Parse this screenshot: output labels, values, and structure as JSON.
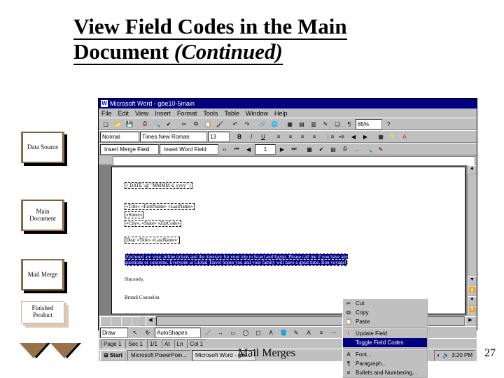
{
  "title_line1": "View Field Codes in the Main",
  "title_line2a": "Document ",
  "title_line2b": "(Continued)",
  "side_buttons": {
    "data_source": "Data Source",
    "main_doc": "Main Document",
    "mail_merge": "Mail Merge",
    "finished": "Finished Product"
  },
  "word": {
    "title": "Microsoft Word - gbe10-5main",
    "menus": [
      "File",
      "Edit",
      "View",
      "Insert",
      "Format",
      "Tools",
      "Table",
      "Window",
      "Help"
    ],
    "style_combo": "Normal",
    "font_combo": "Times New Roman",
    "size_combo": "13",
    "zoom": "85%",
    "mm_insert_field": "Insert Merge Field",
    "mm_insert_word": "Insert Word Field",
    "mm_recnum": "1",
    "doc": {
      "date": "{ DATE \\@ \"MMMM d, yyyy\" }",
      "addr1": "«Title» «FirstName» «LastName»",
      "addr2": "«Street»",
      "addr3": "«City», «State» «ZipCode»",
      "salut": "Dear «Title» «LastName»:",
      "body": "Enclosed are your airline tickets and the itinerary for your trip to Israel and Egypt. Please call me if you have any questions or concerns. Everyone at Global Travel hopes you and your family will have a great time. Bon voyage!",
      "closing": "Sincerely,",
      "sig": "Brandi Courselon"
    },
    "context": {
      "cut": "Cut",
      "copy": "Copy",
      "paste": "Paste",
      "update": "Update Field",
      "toggle": "Toggle Field Codes",
      "font": "Font...",
      "para": "Paragraph...",
      "bullets": "Bullets and Numbering..."
    },
    "draw_label": "Draw",
    "autoshapes": "AutoShapes",
    "status": {
      "page": "Page 1",
      "sec": "Sec 1",
      "pages": "1/1",
      "at": "At",
      "ln": "Ln",
      "col": "Col 1"
    },
    "taskbar": {
      "start": "Start",
      "task1": "Microsoft PowerPoin...",
      "task2": "Microsoft Word - gbe...",
      "time": "3:20 PM"
    }
  },
  "footer": "Mail Merges",
  "page_number": "27"
}
